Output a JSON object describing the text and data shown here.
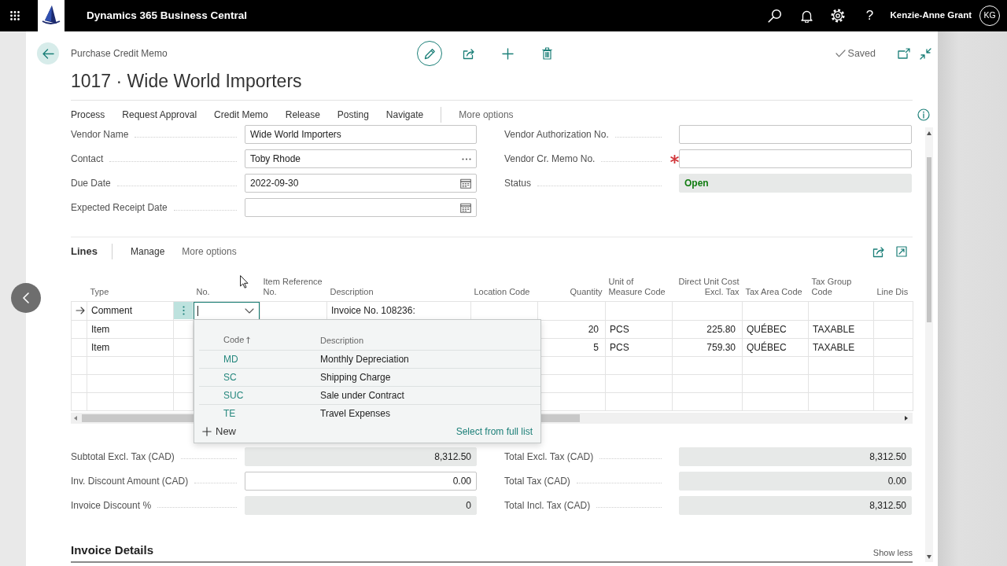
{
  "app_bar": {
    "title": "Dynamics 365 Business Central",
    "help": "?",
    "user_name": "Kenzie-Anne Grant",
    "user_initials": "KG"
  },
  "header": {
    "breadcrumb": "Purchase Credit Memo",
    "title": "1017 · Wide World Importers",
    "save_status": "Saved"
  },
  "action_bar": {
    "items": [
      "Process",
      "Request Approval",
      "Credit Memo",
      "Release",
      "Posting",
      "Navigate"
    ],
    "more": "More options"
  },
  "general": {
    "left": [
      {
        "label": "Vendor Name",
        "kind": "text",
        "value": "Wide World Importers"
      },
      {
        "label": "Contact",
        "kind": "lookup",
        "value": "Toby Rhode"
      },
      {
        "label": "Due Date",
        "kind": "date",
        "value": "2022-09-30"
      },
      {
        "label": "Expected Receipt Date",
        "kind": "date"
      }
    ],
    "right": [
      {
        "label": "Vendor Authorization No.",
        "kind": "text",
        "required": false
      },
      {
        "label": "Vendor Cr. Memo No.",
        "kind": "text",
        "required": true
      },
      {
        "label": "Status",
        "kind": "status",
        "value": "Open",
        "required": false
      }
    ]
  },
  "lines": {
    "title": "Lines",
    "actions": [
      "Manage",
      "More options"
    ],
    "columns": [
      {
        "label": "Type",
        "kind": "text"
      },
      {
        "label": "No.",
        "kind": "text"
      },
      {
        "label": "Item Reference No.",
        "kind": "text"
      },
      {
        "label": "Description",
        "kind": "text"
      },
      {
        "label": "Location Code",
        "kind": "text"
      },
      {
        "label": "Quantity",
        "kind": "number"
      },
      {
        "label": "Unit of Measure Code",
        "kind": "text"
      },
      {
        "label": "Direct Unit Cost Excl. Tax",
        "kind": "number"
      },
      {
        "label": "Tax Area Code",
        "kind": "text"
      },
      {
        "label": "Tax Group Code",
        "kind": "text"
      },
      {
        "label": "Line Dis",
        "kind": "text"
      }
    ],
    "rows": [
      {
        "selected": true,
        "cells": [
          "Comment",
          {
            "kind": "dropdown"
          },
          null,
          "Invoice No. 108236:",
          null,
          null,
          null,
          null,
          null,
          null,
          null
        ]
      },
      {
        "selected": false,
        "cells": [
          "Item",
          null,
          null,
          null,
          null,
          "20",
          "PCS",
          "225.80",
          "QUÉBEC",
          "TAXABLE",
          null
        ]
      },
      {
        "selected": false,
        "cells": [
          "Item",
          null,
          null,
          null,
          null,
          "5",
          "PCS",
          "759.30",
          "QUÉBEC",
          "TAXABLE",
          null
        ]
      }
    ],
    "lookup": {
      "expanded": true,
      "columns": [
        {
          "label": "Code",
          "sorted": true
        },
        {
          "label": "Description",
          "sorted": false
        }
      ],
      "options": [
        {
          "code": "MD",
          "description": "Monthly Depreciation"
        },
        {
          "code": "SC",
          "description": "Shipping Charge"
        },
        {
          "code": "SUC",
          "description": "Sale under Contract"
        },
        {
          "code": "TE",
          "description": "Travel Expenses"
        }
      ],
      "new_label": "New",
      "full_list_label": "Select from full list"
    }
  },
  "totals": {
    "left": [
      {
        "label": "Subtotal Excl. Tax (CAD)",
        "kind": "readonly",
        "value": "8,312.50"
      },
      {
        "label": "Inv. Discount Amount (CAD)",
        "kind": "editable",
        "value": "0.00"
      },
      {
        "label": "Invoice Discount %",
        "kind": "readonly",
        "value": "0"
      }
    ],
    "right": [
      {
        "label": "Total Excl. Tax (CAD)",
        "kind": "readonly",
        "value": "8,312.50"
      },
      {
        "label": "Total Tax (CAD)",
        "kind": "readonly",
        "value": "0.00"
      },
      {
        "label": "Total Incl. Tax (CAD)",
        "kind": "readonly",
        "value": "8,312.50"
      }
    ]
  },
  "invoice_details": {
    "title": "Invoice Details",
    "toggle": "Show less"
  }
}
